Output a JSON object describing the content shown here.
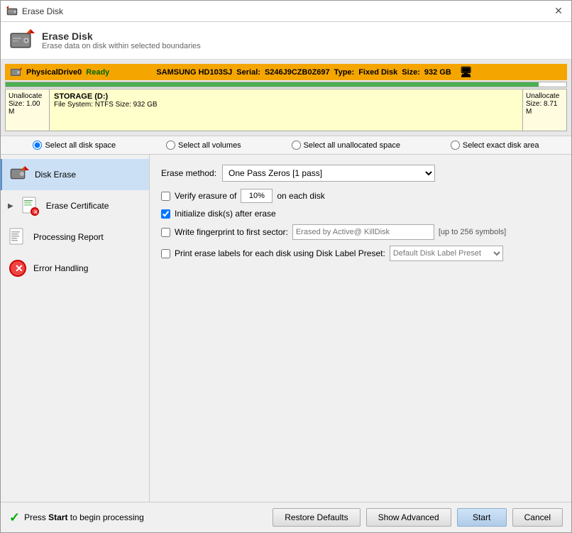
{
  "window": {
    "title": "Erase Disk"
  },
  "header": {
    "title": "Erase Disk",
    "subtitle": "Erase data on disk within selected boundaries"
  },
  "disk": {
    "name": "PhysicalDrive0",
    "status": "Ready",
    "model": "SAMSUNG HD103SJ",
    "serial_label": "Serial:",
    "serial": "S246J9CZB0Z697",
    "type_label": "Type:",
    "type": "Fixed Disk",
    "size_label": "Size:",
    "size": "932 GB",
    "partition_left_label": "Unallocate",
    "partition_left_size": "Size: 1.00 M",
    "partition_storage_name": "STORAGE (D:)",
    "partition_storage_fs": "File System: NTFS Size: 932 GB",
    "partition_right_label": "Unallocate",
    "partition_right_size": "Size: 8.71 M"
  },
  "select_options": [
    "Select all disk space",
    "Select all volumes",
    "Select all unallocated space",
    "Select exact disk area"
  ],
  "sidebar": {
    "items": [
      {
        "label": "Disk Erase",
        "icon": "disk-erase-icon"
      },
      {
        "label": "Erase Certificate",
        "icon": "erase-cert-icon"
      },
      {
        "label": "Processing Report",
        "icon": "processing-report-icon"
      },
      {
        "label": "Error Handling",
        "icon": "error-handling-icon"
      }
    ]
  },
  "right_panel": {
    "erase_method_label": "Erase method:",
    "erase_method_value": "One Pass Zeros [1 pass]",
    "verify_label": "Verify erasure of",
    "verify_percent": "10%",
    "verify_suffix": "on each disk",
    "initialize_label": "Initialize disk(s) after erase",
    "fingerprint_label": "Write fingerprint to first sector:",
    "fingerprint_placeholder": "Erased by Active@ KillDisk",
    "fingerprint_hint": "[up to 256 symbols]",
    "print_labels_label": "Print erase labels for each disk using Disk Label Preset:",
    "disk_label_preset": "Default Disk Label Preset"
  },
  "bottom": {
    "status_prefix": "Press ",
    "status_bold": "Start",
    "status_suffix": " to begin processing",
    "btn_restore": "Restore Defaults",
    "btn_advanced": "Show Advanced",
    "btn_start": "Start",
    "btn_cancel": "Cancel"
  }
}
